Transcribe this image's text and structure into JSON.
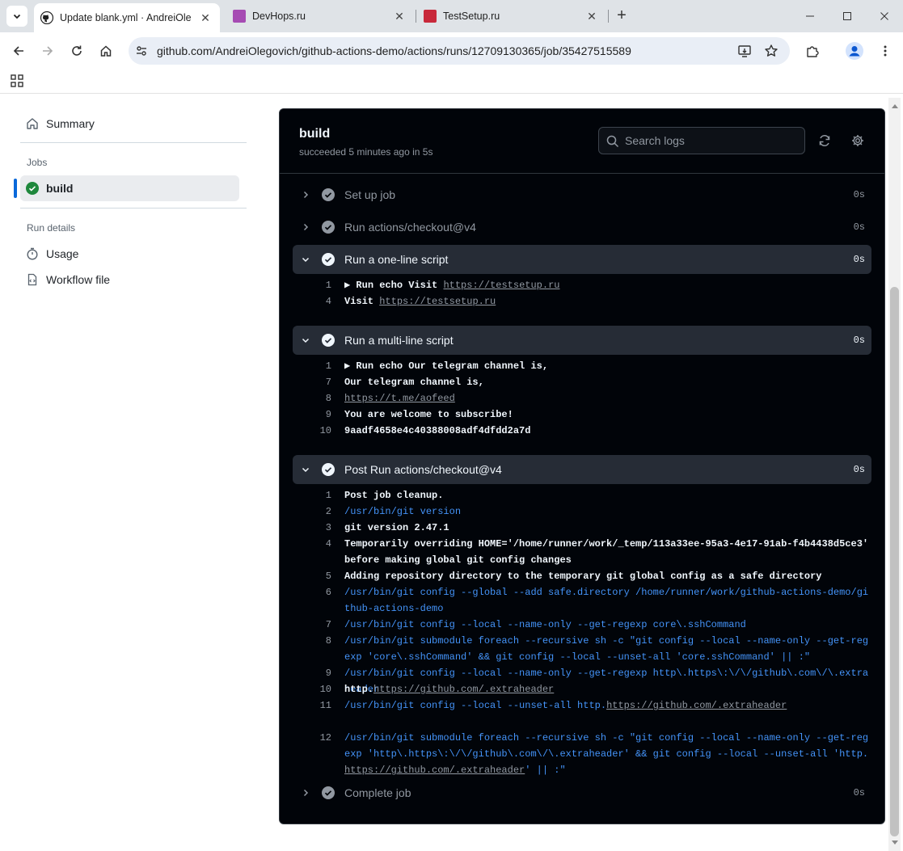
{
  "browser": {
    "tabs": [
      {
        "title": "Update blank.yml · AndreiOlegovich/github-actions-demo",
        "active": true
      },
      {
        "title": "DevHops.ru",
        "active": false
      },
      {
        "title": "TestSetup.ru",
        "active": false
      }
    ],
    "url": "github.com/AndreiOlegovich/github-actions-demo/actions/runs/12709130365/job/35427515589",
    "new_tab_label": "+",
    "close_glyph": "✕"
  },
  "sidebar": {
    "summary_label": "Summary",
    "jobs_heading": "Jobs",
    "job_label": "build",
    "run_details_heading": "Run details",
    "usage_label": "Usage",
    "workflow_file_label": "Workflow file"
  },
  "logs": {
    "job_title": "build",
    "job_status": "succeeded 5 minutes ago in 5s",
    "search_placeholder": "Search logs",
    "steps": [
      {
        "name": "Set up job",
        "duration": "0s",
        "expanded": false
      },
      {
        "name": "Run actions/checkout@v4",
        "duration": "0s",
        "expanded": false
      },
      {
        "name": "Run a one-line script",
        "duration": "0s",
        "expanded": true,
        "lines": [
          {
            "n": "1",
            "text": "▶ Run echo Visit ",
            "link": "https://testsetup.ru",
            "after": ""
          },
          {
            "n": "4",
            "text": "Visit ",
            "link": "https://testsetup.ru",
            "after": ""
          }
        ]
      },
      {
        "name": "Run a multi-line script",
        "duration": "0s",
        "expanded": true,
        "lines": [
          {
            "n": "1",
            "text": "▶ Run echo Our telegram channel is,"
          },
          {
            "n": "7",
            "text": "Our telegram channel is,"
          },
          {
            "n": "8",
            "text": "",
            "link": "https://t.me/aofeed",
            "after": ""
          },
          {
            "n": "9",
            "text": "You are welcome to subscribe!"
          },
          {
            "n": "10",
            "text": "9aadf4658e4c40388008adf4dfdd2a7d"
          }
        ]
      },
      {
        "name": "Post Run actions/checkout@v4",
        "duration": "0s",
        "expanded": true,
        "lines": [
          {
            "n": "1",
            "text": "Post job cleanup."
          },
          {
            "n": "2",
            "text": "/usr/bin/git version",
            "cmd": true
          },
          {
            "n": "3",
            "text": "git version 2.47.1"
          },
          {
            "n": "4",
            "text": "Temporarily overriding HOME='/home/runner/work/_temp/113a33ee-95a3-4e17-91ab-f4b4438d5ce3' before making global git config changes"
          },
          {
            "n": "5",
            "text": "Adding repository directory to the temporary git global config as a safe directory"
          },
          {
            "n": "6",
            "text": "/usr/bin/git config --global --add safe.directory /home/runner/work/github-actions-demo/github-actions-demo",
            "cmd": true
          },
          {
            "n": "7",
            "text": "/usr/bin/git config --local --name-only --get-regexp core\\.sshCommand",
            "cmd": true
          },
          {
            "n": "8",
            "text": "/usr/bin/git submodule foreach --recursive sh -c \"git config --local --name-only --get-regexp 'core\\.sshCommand' && git config --local --unset-all 'core.sshCommand' || :\"",
            "cmd": true
          },
          {
            "n": "9",
            "text": "/usr/bin/git config --local --name-only --get-regexp http\\.https\\:\\/\\/github\\.com\\/\\.extraheader",
            "cmd": true
          },
          {
            "n": "10",
            "text": "http.",
            "link": "https://github.com/.extraheader",
            "after": ""
          },
          {
            "n": "11",
            "text": "/usr/bin/git config --local --unset-all http.",
            "link": "https://github.com/.extraheader",
            "after": "",
            "cmd": true
          },
          {
            "n": "12",
            "text": "/usr/bin/git submodule foreach --recursive sh -c \"git config --local --name-only --get-regexp 'http\\.https\\:\\/\\/github\\.com\\/\\.extraheader' && git config --local --unset-all 'http.",
            "link": "https://github.com/.extraheader",
            "after": "' || :\"",
            "cmd": true
          }
        ]
      },
      {
        "name": "Complete job",
        "duration": "0s",
        "expanded": false
      }
    ]
  },
  "colors": {
    "accent": "#0969da",
    "success": "#1f883d",
    "log_bg": "#010409",
    "step_bg": "#262c36",
    "cmd_blue": "#4493f8"
  }
}
